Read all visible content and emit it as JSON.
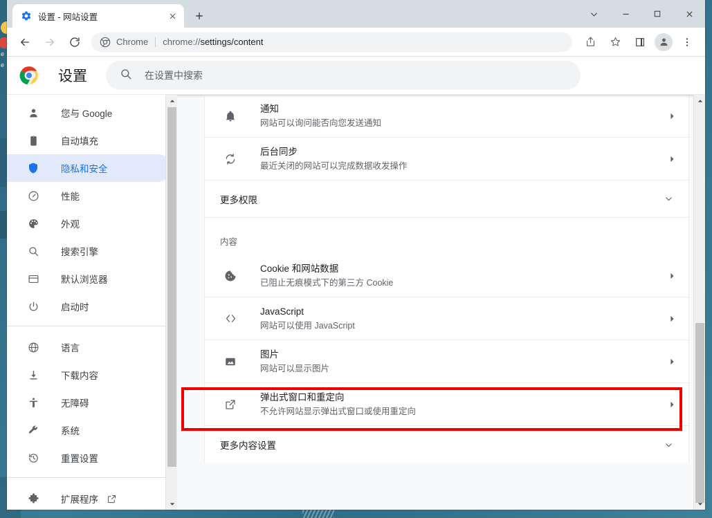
{
  "window": {
    "controls": {
      "tab_search": "⌄",
      "minimize": "—",
      "maximize": "□",
      "close": "✕"
    }
  },
  "tabstrip": {
    "tabs": [
      {
        "title": "设置 - 网站设置",
        "favicon": "gear-icon",
        "close": "✕"
      }
    ],
    "new_tab": "+"
  },
  "toolbar": {
    "back": "←",
    "forward": "→",
    "reload": "⟳",
    "omnibox": {
      "chip": "Chrome",
      "url_prefix": "chrome://",
      "url_main": "settings/content",
      "full_url": "chrome://settings/content"
    },
    "share": "share-icon",
    "bookmark": "star-icon",
    "side_panel": "side-panel-icon",
    "profile": "avatar-icon",
    "menu": "⋮"
  },
  "settings_header": {
    "title": "设置",
    "search_placeholder": "在设置中搜索"
  },
  "sidebar": {
    "group1": [
      {
        "label": "您与 Google",
        "icon": "person-icon",
        "selected": false
      },
      {
        "label": "自动填充",
        "icon": "clipboard-icon",
        "selected": false
      },
      {
        "label": "隐私和安全",
        "icon": "shield-icon",
        "selected": true
      },
      {
        "label": "性能",
        "icon": "speedometer-icon",
        "selected": false
      },
      {
        "label": "外观",
        "icon": "palette-icon",
        "selected": false
      },
      {
        "label": "搜索引擎",
        "icon": "search-icon",
        "selected": false
      },
      {
        "label": "默认浏览器",
        "icon": "browser-window-icon",
        "selected": false
      },
      {
        "label": "启动时",
        "icon": "power-icon",
        "selected": false
      }
    ],
    "group2": [
      {
        "label": "语言",
        "icon": "globe-icon"
      },
      {
        "label": "下载内容",
        "icon": "download-icon"
      },
      {
        "label": "无障碍",
        "icon": "accessibility-icon"
      },
      {
        "label": "系统",
        "icon": "wrench-icon"
      },
      {
        "label": "重置设置",
        "icon": "history-restore-icon"
      }
    ],
    "group3": [
      {
        "label": "扩展程序",
        "icon": "puzzle-icon",
        "external": "external-link-icon"
      }
    ]
  },
  "main": {
    "permission_rows": [
      {
        "icon": "bell-icon",
        "title": "通知",
        "subtitle": "网站可以询问能否向您发送通知",
        "arrow": "▸"
      },
      {
        "icon": "sync-icon",
        "title": "后台同步",
        "subtitle": "最近关闭的网站可以完成数据收发操作",
        "arrow": "▸"
      }
    ],
    "more_permissions": {
      "label": "更多权限",
      "chevron": "⌄"
    },
    "content_section_label": "内容",
    "content_rows": [
      {
        "icon": "cookie-icon",
        "title": "Cookie 和网站数据",
        "subtitle": "已阻止无痕模式下的第三方 Cookie",
        "arrow": "▸"
      },
      {
        "icon": "code-brackets-icon",
        "title": "JavaScript",
        "subtitle": "网站可以使用 JavaScript",
        "arrow": "▸"
      },
      {
        "icon": "image-icon",
        "title": "图片",
        "subtitle": "网站可以显示图片",
        "arrow": "▸"
      },
      {
        "icon": "popup-redirect-icon",
        "title": "弹出式窗口和重定向",
        "subtitle": "不允许网站显示弹出式窗口或使用重定向",
        "arrow": "▸",
        "highlighted": true
      }
    ],
    "more_content_settings": {
      "label": "更多内容设置",
      "chevron": "⌄"
    }
  },
  "colors": {
    "accent": "#1a73e8",
    "selected_nav_bg": "#e1e9fb",
    "highlight_border": "#ef0000",
    "titlebar": "#d6dde1",
    "page_bg": "#f8f9fa",
    "desktop": "#336f8a"
  }
}
